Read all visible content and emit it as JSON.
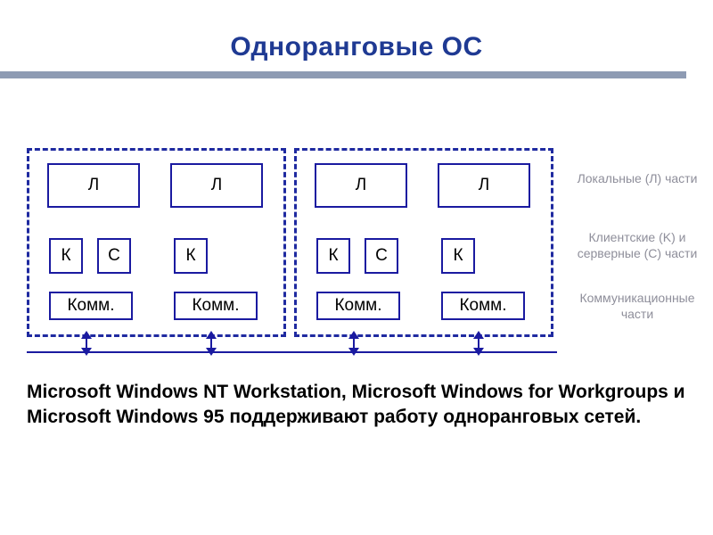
{
  "title": "Одноранговые ОС",
  "legend": {
    "local": "Локальные (Л) части",
    "client_server": "Клиентские (K) и серверные (C) части",
    "comm": "Коммуникационные части"
  },
  "labels": {
    "L": "Л",
    "K": "К",
    "C": "С",
    "Comm": "Комм."
  },
  "groups": [
    {
      "peers": [
        {
          "has_local": true,
          "has_client": true,
          "has_server": true,
          "has_comm": true
        },
        {
          "has_local": true,
          "has_client": true,
          "has_server": false,
          "has_comm": true
        }
      ]
    },
    {
      "peers": [
        {
          "has_local": true,
          "has_client": true,
          "has_server": true,
          "has_comm": true
        },
        {
          "has_local": true,
          "has_client": true,
          "has_server": false,
          "has_comm": true
        }
      ]
    }
  ],
  "footer": "Microsoft Windows NT Workstation, Microsoft Windows for Workgroups и Microsoft Windows 95 поддерживают работу одноранговых сетей."
}
